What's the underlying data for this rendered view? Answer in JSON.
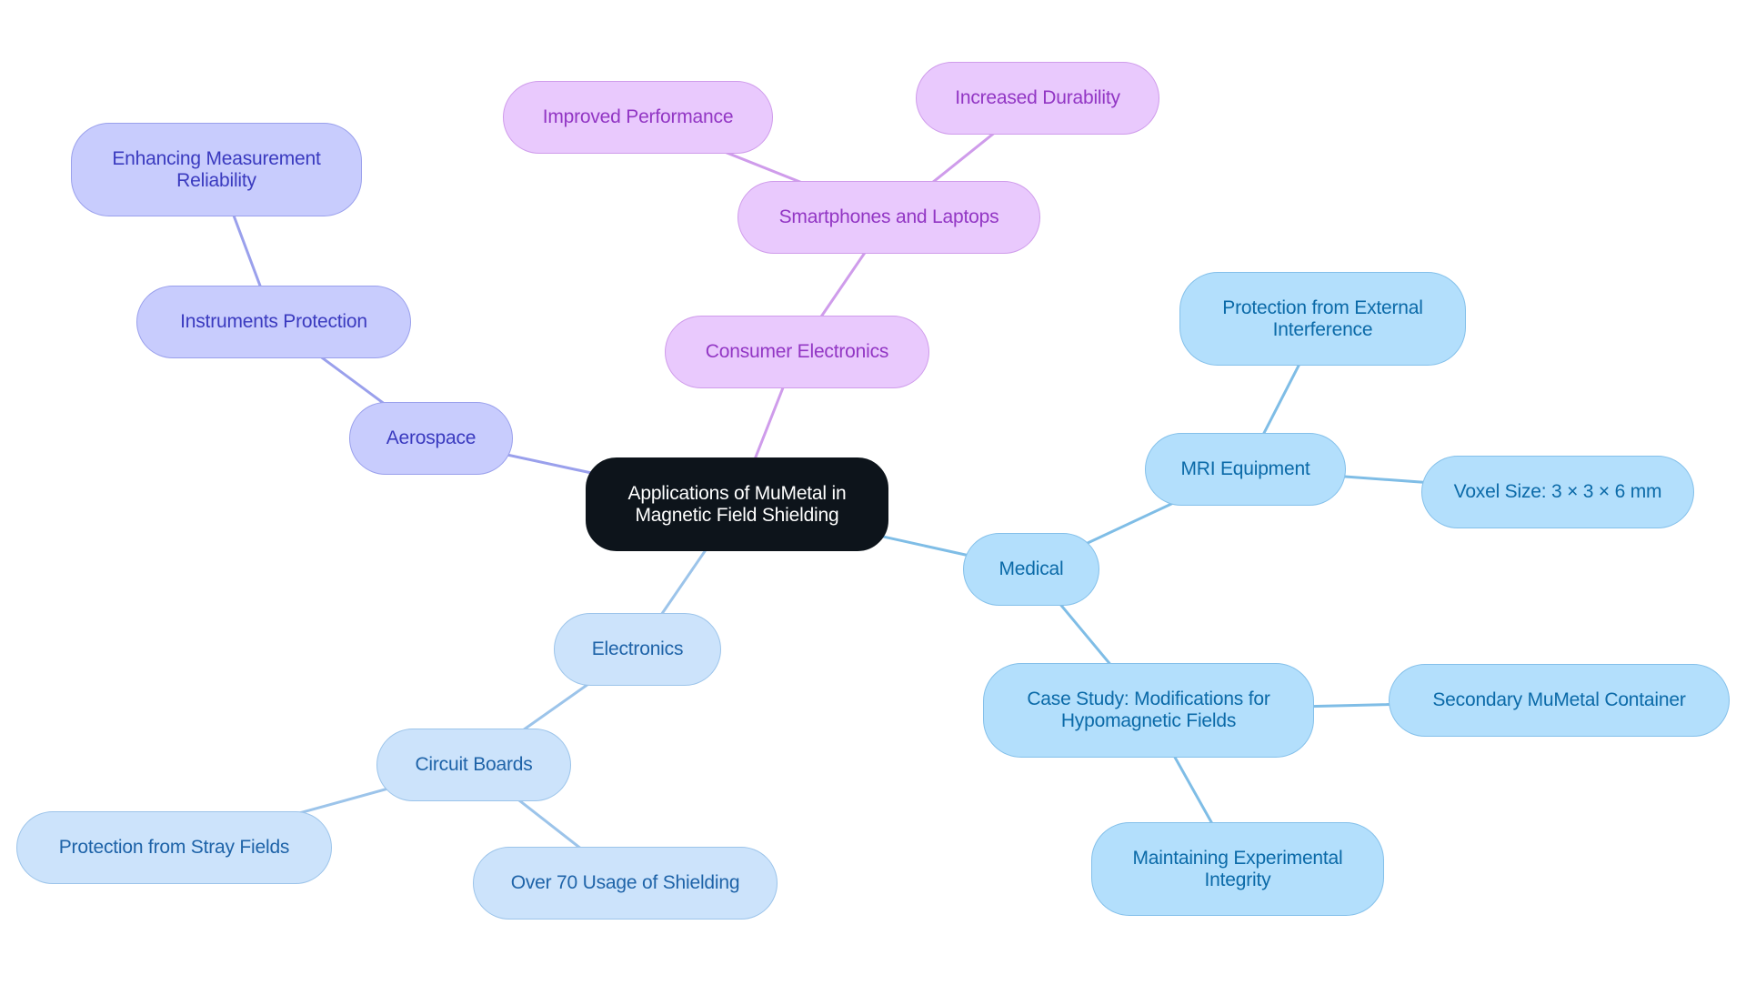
{
  "diagram": {
    "type": "mindmap",
    "root": {
      "id": "root",
      "label_lines": [
        "Applications of MuMetal in",
        "Magnetic Field Shielding"
      ]
    },
    "branch_colors": {
      "aerospace": {
        "fill": "#c8ccfd",
        "stroke": "#9aa0ec",
        "text": "#3a3abf",
        "edge": "#9aa0ec"
      },
      "consumer": {
        "fill": "#e9c9fd",
        "stroke": "#cf9ceb",
        "text": "#9236c4",
        "edge": "#cf9ceb"
      },
      "medical": {
        "fill": "#b3dffc",
        "stroke": "#84c0ea",
        "text": "#0b6aa8",
        "edge": "#7fbde6"
      },
      "electronics": {
        "fill": "#cce3fb",
        "stroke": "#9cc4ea",
        "text": "#1e63a8",
        "edge": "#9cc4ea"
      },
      "root": {
        "fill": "#0d141b",
        "text": "#ffffff"
      }
    },
    "nodes": {
      "aerospace": {
        "label_lines": [
          "Aerospace"
        ],
        "parent": "root",
        "branch": "aerospace"
      },
      "instruments": {
        "label_lines": [
          "Instruments Protection"
        ],
        "parent": "aerospace",
        "branch": "aerospace"
      },
      "enhancing": {
        "label_lines": [
          "Enhancing Measurement",
          "Reliability"
        ],
        "parent": "instruments",
        "branch": "aerospace"
      },
      "consumer": {
        "label_lines": [
          "Consumer Electronics"
        ],
        "parent": "root",
        "branch": "consumer"
      },
      "smartphones": {
        "label_lines": [
          "Smartphones and Laptops"
        ],
        "parent": "consumer",
        "branch": "consumer"
      },
      "improved": {
        "label_lines": [
          "Improved Performance"
        ],
        "parent": "smartphones",
        "branch": "consumer"
      },
      "durability": {
        "label_lines": [
          "Increased Durability"
        ],
        "parent": "smartphones",
        "branch": "consumer"
      },
      "medical": {
        "label_lines": [
          "Medical"
        ],
        "parent": "root",
        "branch": "medical"
      },
      "mri": {
        "label_lines": [
          "MRI Equipment"
        ],
        "parent": "medical",
        "branch": "medical"
      },
      "external": {
        "label_lines": [
          "Protection from External",
          "Interference"
        ],
        "parent": "mri",
        "branch": "medical"
      },
      "voxel": {
        "label_lines": [
          "Voxel Size: 3 × 3 × 6 mm"
        ],
        "parent": "mri",
        "branch": "medical"
      },
      "casestudy": {
        "label_lines": [
          "Case Study: Modifications for",
          "Hypomagnetic Fields"
        ],
        "parent": "medical",
        "branch": "medical"
      },
      "secondary": {
        "label_lines": [
          "Secondary MuMetal Container"
        ],
        "parent": "casestudy",
        "branch": "medical"
      },
      "maintaining": {
        "label_lines": [
          "Maintaining Experimental",
          "Integrity"
        ],
        "parent": "casestudy",
        "branch": "medical"
      },
      "electronics": {
        "label_lines": [
          "Electronics"
        ],
        "parent": "root",
        "branch": "electronics"
      },
      "circuit": {
        "label_lines": [
          "Circuit Boards"
        ],
        "parent": "electronics",
        "branch": "electronics"
      },
      "stray": {
        "label_lines": [
          "Protection from Stray Fields"
        ],
        "parent": "circuit",
        "branch": "electronics"
      },
      "over70": {
        "label_lines": [
          "Over 70 Usage of Shielding"
        ],
        "parent": "circuit",
        "branch": "electronics"
      }
    }
  }
}
